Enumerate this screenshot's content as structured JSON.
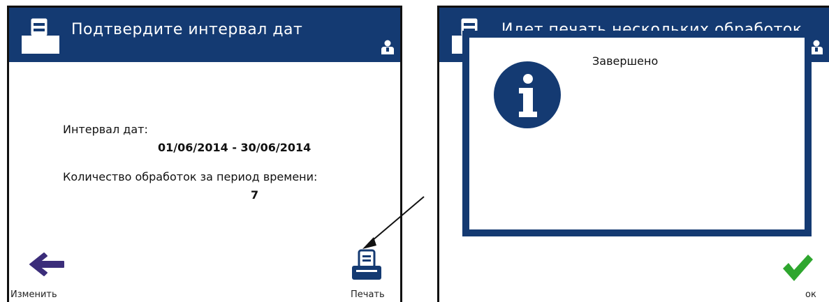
{
  "left_screen": {
    "title": "Подтвердите интервал дат",
    "date_range_label": "Интервал дат:",
    "date_range_value": "01/06/2014 - 30/06/2014",
    "count_label": "Количество обработок за период времени:",
    "count_value": "7",
    "back_label": "Изменить",
    "print_label": "Печать"
  },
  "right_screen": {
    "title": "Идет печать нескольких обработок",
    "dialog_message": "Завершено",
    "ok_label": "ок"
  },
  "icons": {
    "header_icon": "printer-icon",
    "user_icon": "user-icon",
    "back_icon": "arrow-left-icon",
    "print_icon": "printer-icon",
    "info_icon": "info-icon",
    "ok_icon": "checkmark-icon",
    "annotation": "arrow-annotation"
  },
  "colors": {
    "header": "#143a72",
    "back_arrow": "#3b2d7a",
    "checkmark": "#2ea62e"
  }
}
